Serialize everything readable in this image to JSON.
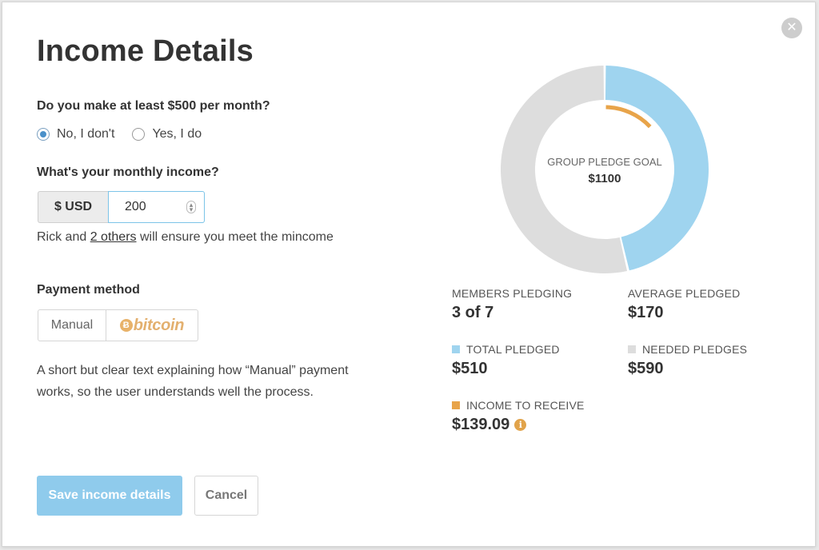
{
  "modal": {
    "title": "Income Details",
    "close_icon": "close-icon"
  },
  "income_question": {
    "label": "Do you make at least $500 per month?",
    "options": [
      {
        "label": "No, I don't",
        "selected": true
      },
      {
        "label": "Yes, I do",
        "selected": false
      }
    ]
  },
  "monthly_income": {
    "label": "What's your monthly income?",
    "currency": "$ USD",
    "value": "200",
    "helper_prefix": "Rick and ",
    "helper_link": "2 others",
    "helper_suffix": " will ensure you meet the mincome"
  },
  "payment": {
    "label": "Payment method",
    "manual": "Manual",
    "bitcoin_word": "bitcoin",
    "bitcoin_symbol": "Ƀ",
    "description": "A short but clear text explaining how “Manual” payment works, so the user understands well the process."
  },
  "buttons": {
    "save": "Save income details",
    "cancel": "Cancel"
  },
  "chart_data": {
    "type": "pie",
    "center_label": "GROUP PLEDGE GOAL",
    "center_value": "$1100",
    "goal": 1100,
    "slices": [
      {
        "name": "TOTAL PLEDGED",
        "value": 510,
        "color": "#9fd4ef"
      },
      {
        "name": "NEEDED PLEDGES",
        "value": 590,
        "color": "#dddddd"
      }
    ],
    "inner_arc": {
      "name": "INCOME TO RECEIVE",
      "value": 139.09,
      "color": "#e8a44a"
    }
  },
  "stats": {
    "members_pledging": {
      "label": "MEMBERS PLEDGING",
      "value": "3 of 7"
    },
    "average_pledged": {
      "label": "AVERAGE PLEDGED",
      "value": "$170"
    },
    "total_pledged": {
      "label": "TOTAL PLEDGED",
      "value": "$510",
      "color": "#9fd4ef"
    },
    "needed_pledges": {
      "label": "NEEDED PLEDGES",
      "value": "$590",
      "color": "#dddddd"
    },
    "income_to_receive": {
      "label": "INCOME TO RECEIVE",
      "value": "$139.09",
      "color": "#e8a44a",
      "info_icon": "info-icon"
    }
  }
}
